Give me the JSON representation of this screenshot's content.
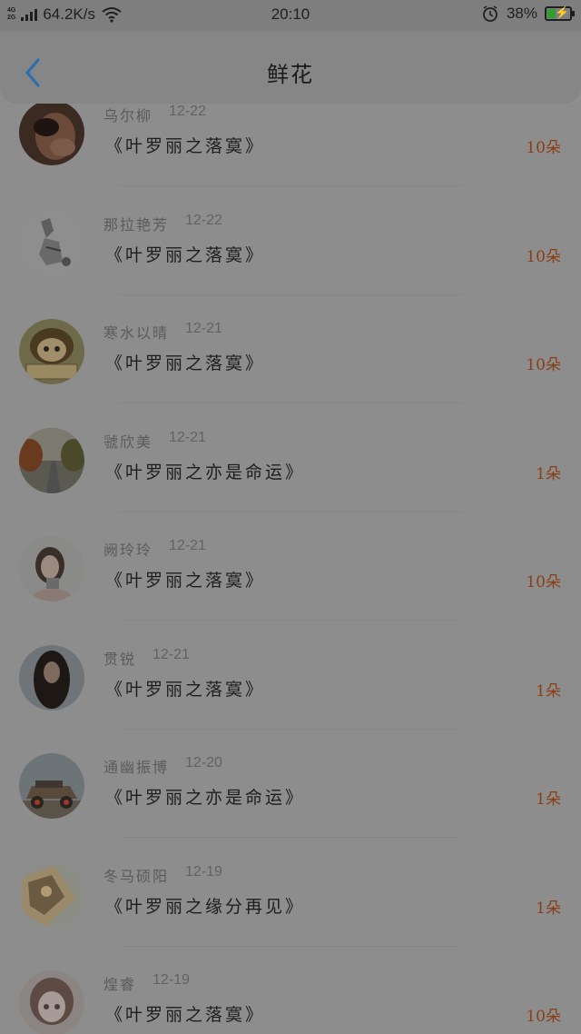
{
  "status_bar": {
    "net_top": "4G",
    "net_bottom": "2G",
    "speed": "64.2K/s",
    "time": "20:10",
    "battery": "38%",
    "battery_level": 0.38,
    "icons": [
      "signal-icon",
      "wifi-icon",
      "alarm-icon",
      "battery-icon"
    ]
  },
  "header": {
    "title": "鲜花",
    "back_icon": "chevron-left-icon",
    "accent": "#2b6fae"
  },
  "colors": {
    "count": "#8a3e14",
    "overlay_bg": "#8d8d8d"
  },
  "items": [
    {
      "name": "乌尔柳",
      "date": "12-22",
      "book": "《叶罗丽之落寞》",
      "count": "10朵"
    },
    {
      "name": "那拉艳芳",
      "date": "12-22",
      "book": "《叶罗丽之落寞》",
      "count": "10朵"
    },
    {
      "name": "寒水以晴",
      "date": "12-21",
      "book": "《叶罗丽之落寞》",
      "count": "10朵"
    },
    {
      "name": "虢欣美",
      "date": "12-21",
      "book": "《叶罗丽之亦是命运》",
      "count": "1朵"
    },
    {
      "name": "阙玲玲",
      "date": "12-21",
      "book": "《叶罗丽之落寞》",
      "count": "10朵"
    },
    {
      "name": "贯锐",
      "date": "12-21",
      "book": "《叶罗丽之落寞》",
      "count": "1朵"
    },
    {
      "name": "通幽振博",
      "date": "12-20",
      "book": "《叶罗丽之亦是命运》",
      "count": "1朵"
    },
    {
      "name": "冬马硕阳",
      "date": "12-19",
      "book": "《叶罗丽之缘分再见》",
      "count": "1朵"
    },
    {
      "name": "煌睿",
      "date": "12-19",
      "book": "《叶罗丽之落寞》",
      "count": "10朵"
    }
  ]
}
